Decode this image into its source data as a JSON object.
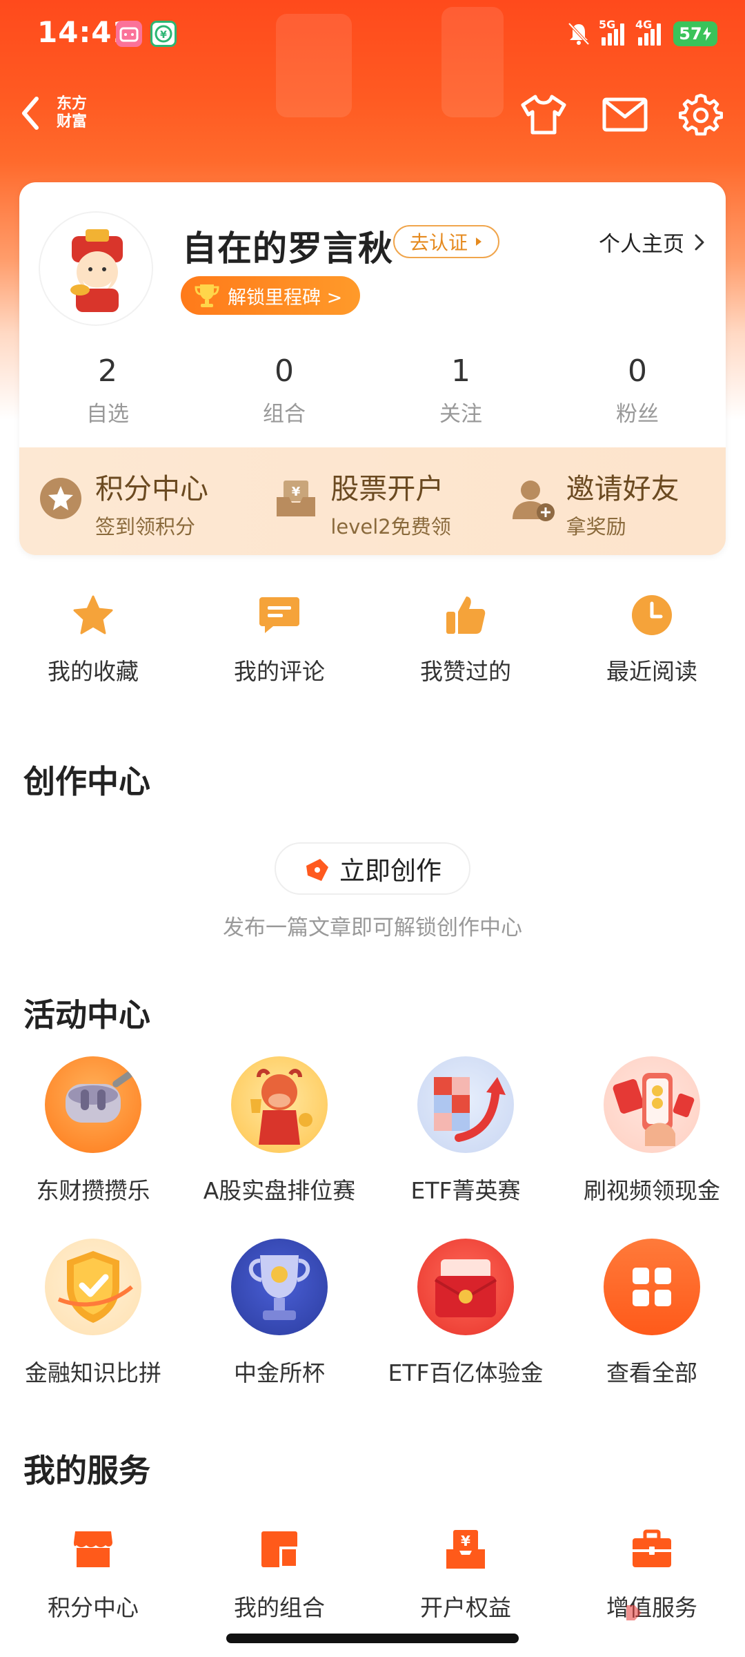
{
  "status_bar": {
    "time": "14:41",
    "network_1": "5G",
    "network_2": "4G",
    "battery": "57"
  },
  "header": {
    "brand_line1": "东方",
    "brand_line2": "财富"
  },
  "profile": {
    "username": "自在的罗言秋",
    "verify_label": "去认证",
    "homepage_label": "个人主页",
    "milestone_label": "解锁里程碑 >",
    "stats": [
      {
        "value": "2",
        "label": "自选"
      },
      {
        "value": "0",
        "label": "组合"
      },
      {
        "value": "1",
        "label": "关注"
      },
      {
        "value": "0",
        "label": "粉丝"
      }
    ],
    "promos": [
      {
        "title": "积分中心",
        "subtitle": "签到领积分",
        "icon": "points-star-icon"
      },
      {
        "title": "股票开户",
        "subtitle": "level2免费领",
        "icon": "account-open-icon"
      },
      {
        "title": "邀请好友",
        "subtitle": "拿奖励",
        "icon": "invite-friend-icon"
      }
    ]
  },
  "quick_actions": [
    {
      "label": "我的收藏",
      "icon": "star-icon"
    },
    {
      "label": "我的评论",
      "icon": "comment-icon"
    },
    {
      "label": "我赞过的",
      "icon": "thumbs-up-icon"
    },
    {
      "label": "最近阅读",
      "icon": "clock-icon"
    }
  ],
  "creation": {
    "title": "创作中心",
    "button_label": "立即创作",
    "hint": "发布一篇文章即可解锁创作中心"
  },
  "activities": {
    "title": "活动中心",
    "items": [
      {
        "label": "东财攒攒乐",
        "icon": "earbuds-prize-icon"
      },
      {
        "label": "A股实盘排位赛",
        "icon": "bull-trophy-icon"
      },
      {
        "label": "ETF菁英赛",
        "icon": "cubes-arrow-icon"
      },
      {
        "label": "刷视频领现金",
        "icon": "phone-redpacket-icon"
      },
      {
        "label": "金融知识比拼",
        "icon": "shield-check-icon"
      },
      {
        "label": "中金所杯",
        "icon": "trophy-cup-icon"
      },
      {
        "label": "ETF百亿体验金",
        "icon": "gift-envelope-icon"
      },
      {
        "label": "查看全部",
        "icon": "grid-all-icon"
      }
    ]
  },
  "services": {
    "title": "我的服务",
    "items": [
      {
        "label": "积分中心",
        "icon": "store-icon"
      },
      {
        "label": "我的组合",
        "icon": "portfolio-icon"
      },
      {
        "label": "开户权益",
        "icon": "yen-box-icon"
      },
      {
        "label": "增值服务",
        "icon": "briefcase-icon"
      }
    ]
  },
  "colors": {
    "brand_orange": "#ff5a22",
    "accent_orange": "#f5a33a",
    "promo_bg": "#fde6cf"
  }
}
